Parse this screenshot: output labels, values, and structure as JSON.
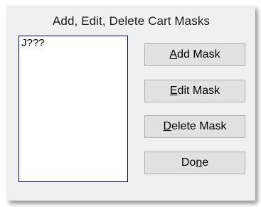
{
  "dialog": {
    "title": "Add, Edit, Delete Cart Masks"
  },
  "mask_list": {
    "items": [
      "J???"
    ]
  },
  "buttons": {
    "add": {
      "pre": "",
      "mnemonic": "A",
      "post": "dd Mask"
    },
    "edit": {
      "pre": "",
      "mnemonic": "E",
      "post": "dit Mask"
    },
    "delete": {
      "pre": "",
      "mnemonic": "D",
      "post": "elete Mask"
    },
    "done": {
      "pre": "Do",
      "mnemonic": "n",
      "post": "e"
    }
  }
}
